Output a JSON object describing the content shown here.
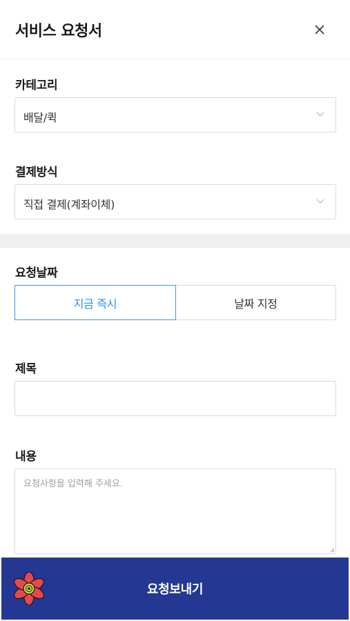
{
  "header": {
    "title": "서비스 요청서"
  },
  "category": {
    "label": "카테고리",
    "selected": "배달/퀵"
  },
  "payment": {
    "label": "결제방식",
    "selected": "직접 결제(계좌이체)"
  },
  "request_date": {
    "label": "요청날짜",
    "option_now": "지금 즉시",
    "option_pick": "날짜 지정",
    "active": "지금 즉시"
  },
  "subject": {
    "label": "제목",
    "value": ""
  },
  "content": {
    "label": "내용",
    "placeholder": "요청사항을 입력해 주세요."
  },
  "submit": {
    "label": "요청보내기"
  },
  "colors": {
    "primary": "#233793",
    "accent": "#3d95e5",
    "band": "#eef0f2"
  },
  "icons": {
    "close": "close-icon",
    "dropdown": "chevron-down-icon",
    "logo": "flower-logo-icon"
  }
}
